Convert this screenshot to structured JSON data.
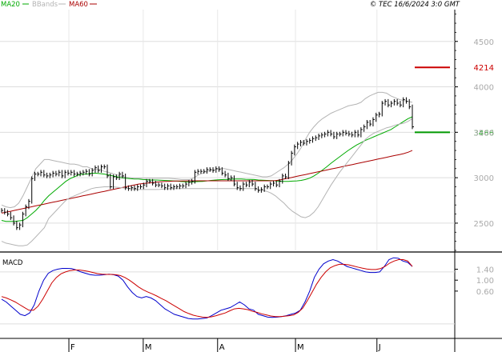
{
  "legend": [
    {
      "label": "MA20",
      "color": "#00aa00"
    },
    {
      "label": "BBands",
      "color": "#b4b4b4"
    },
    {
      "label": "MA60",
      "color": "#aa0000"
    }
  ],
  "copyright": "© TEC 16/6/2024 3:0 GMT",
  "macd_label": "MACD",
  "price_marker": {
    "label": "4214",
    "color": "#cc0000"
  },
  "last_marker": {
    "label": "3466",
    "color": "#009900"
  },
  "chart_data": [
    {
      "type": "line",
      "panel": "price",
      "ylim": [
        2200,
        4850
      ],
      "yticks": [
        2500,
        3000,
        3500,
        4000,
        4500
      ],
      "ytick_labels": [
        "2500",
        "3000",
        "3500",
        "4000",
        "4500"
      ],
      "grid": true,
      "x": [
        "01-04",
        "01-05",
        "01-08",
        "01-09",
        "01-10",
        "01-11",
        "01-12",
        "01-15",
        "01-16",
        "01-17",
        "01-18",
        "01-19",
        "01-22",
        "01-23",
        "01-24",
        "01-25",
        "01-26",
        "01-29",
        "01-30",
        "01-31",
        "02-01",
        "02-02",
        "02-05",
        "02-06",
        "02-07",
        "02-08",
        "02-09",
        "02-12",
        "02-13",
        "02-14",
        "02-15",
        "02-16",
        "02-19",
        "02-20",
        "02-21",
        "02-22",
        "02-23",
        "02-26",
        "02-27",
        "02-28",
        "02-29",
        "03-01",
        "03-04",
        "03-05",
        "03-06",
        "03-07",
        "03-08",
        "03-11",
        "03-12",
        "03-13",
        "03-14",
        "03-15",
        "03-18",
        "03-19",
        "03-20",
        "03-21",
        "03-22",
        "03-25",
        "03-26",
        "03-27",
        "03-28",
        "03-29",
        "04-01",
        "04-02",
        "04-03",
        "04-04",
        "04-05",
        "04-08",
        "04-09",
        "04-10",
        "04-11",
        "04-12",
        "04-15",
        "04-16",
        "04-17",
        "04-18",
        "04-19",
        "04-22",
        "04-23",
        "04-24",
        "04-25",
        "04-26",
        "04-29",
        "04-30",
        "05-01",
        "05-02",
        "05-03",
        "05-06",
        "05-07",
        "05-08",
        "05-09",
        "05-10",
        "05-13",
        "05-14",
        "05-15",
        "05-16",
        "05-17",
        "05-20",
        "05-21",
        "05-22",
        "05-23",
        "05-24",
        "05-27",
        "05-28",
        "05-29",
        "05-30",
        "05-31",
        "06-03",
        "06-04",
        "06-05",
        "06-06",
        "06-07",
        "06-10",
        "06-11",
        "06-12",
        "06-13",
        "06-14"
      ],
      "xtick_labels": [
        {
          "date": "01-31",
          "label": "F"
        },
        {
          "date": "02-29",
          "label": "M"
        },
        {
          "date": "03-29",
          "label": "A"
        },
        {
          "date": "04-30",
          "label": "M"
        },
        {
          "date": "05-31",
          "label": "J"
        }
      ],
      "price": [
        2640,
        2620,
        2600,
        2560,
        2500,
        2450,
        2480,
        2600,
        2680,
        2740,
        2990,
        3040,
        3040,
        3060,
        3030,
        3020,
        3030,
        3050,
        3040,
        3060,
        3020,
        3060,
        3050,
        3060,
        3040,
        3040,
        3050,
        3060,
        3070,
        3040,
        3080,
        3110,
        3080,
        3120,
        3120,
        3020,
        2900,
        3010,
        3000,
        3040,
        3020,
        2890,
        2880,
        2890,
        2880,
        2900,
        2900,
        2920,
        2960,
        2960,
        2940,
        2920,
        2920,
        2910,
        2890,
        2910,
        2890,
        2900,
        2900,
        2910,
        2910,
        2930,
        2950,
        2960,
        3060,
        3070,
        3070,
        3070,
        3090,
        3090,
        3080,
        3100,
        3090,
        3050,
        3030,
        2990,
        3000,
        2930,
        2890,
        2880,
        2930,
        2920,
        2950,
        2930,
        2880,
        2860,
        2870,
        2900,
        2900,
        2930,
        2940,
        2920,
        2960,
        3020,
        3010,
        3160,
        3270,
        3340,
        3370,
        3390,
        3380,
        3400,
        3410,
        3430,
        3440,
        3460,
        3470,
        3480,
        3500,
        3480,
        3450,
        3480,
        3480,
        3500,
        3490,
        3480,
        3470,
        3500,
        3470,
        3530,
        3560,
        3610,
        3590,
        3640,
        3690,
        3700,
        3820,
        3840,
        3800,
        3820,
        3840,
        3820,
        3800,
        3860,
        3840,
        3780,
        3560
      ],
      "series": [
        {
          "name": "MA20",
          "color": "#00aa00",
          "values": [
            2530,
            2520,
            2520,
            2520,
            2525,
            2530,
            2560,
            2600,
            2640,
            2690,
            2750,
            2800,
            2840,
            2880,
            2920,
            2960,
            2990,
            3010,
            3030,
            3040,
            3040,
            3050,
            3050,
            3045,
            3040,
            3030,
            3020,
            3010,
            3000,
            2995,
            2990,
            2985,
            2985,
            2980,
            2978,
            2975,
            2975,
            2972,
            2970,
            2968,
            2965,
            2962,
            2958,
            2955,
            2953,
            2955,
            2958,
            2960,
            2965,
            2970,
            2975,
            2978,
            2980,
            2982,
            2984,
            2985,
            2985,
            2983,
            2982,
            2980,
            2975,
            2972,
            2970,
            2968,
            2965,
            2962,
            2960,
            2960,
            2962,
            2965,
            2970,
            2980,
            2995,
            3020,
            3050,
            3085,
            3120,
            3160,
            3195,
            3230,
            3265,
            3300,
            3330,
            3360,
            3385,
            3410,
            3430,
            3450,
            3470,
            3490,
            3510,
            3530,
            3560,
            3590,
            3620,
            3650,
            3670
          ]
        },
        {
          "name": "MA60",
          "color": "#aa0000",
          "values": [
            2610,
            2620,
            2630,
            2640,
            2650,
            2660,
            2670,
            2680,
            2690,
            2700,
            2710,
            2720,
            2730,
            2740,
            2750,
            2760,
            2770,
            2780,
            2790,
            2800,
            2810,
            2820,
            2830,
            2840,
            2850,
            2860,
            2870,
            2880,
            2890,
            2900,
            2910,
            2920,
            2930,
            2935,
            2940,
            2945,
            2950,
            2955,
            2958,
            2960,
            2962,
            2963,
            2964,
            2965,
            2966,
            2966,
            2966,
            2966,
            2966,
            2966,
            2966,
            2966,
            2966,
            2966,
            2966,
            2966,
            2966,
            2966,
            2966,
            2966,
            2966,
            2966,
            2966,
            2966,
            2968,
            2975,
            2985,
            2995,
            3005,
            3015,
            3025,
            3035,
            3045,
            3055,
            3065,
            3075,
            3085,
            3095,
            3105,
            3115,
            3125,
            3135,
            3145,
            3155,
            3165,
            3175,
            3185,
            3195,
            3205,
            3215,
            3225,
            3235,
            3245,
            3255,
            3265,
            3280,
            3300
          ]
        },
        {
          "name": "BBands upper",
          "color": "#b4b4b4",
          "values": [
            2700,
            2680,
            2670,
            2680,
            2720,
            2800,
            2900,
            3000,
            3100,
            3150,
            3200,
            3200,
            3190,
            3180,
            3170,
            3160,
            3150,
            3150,
            3140,
            3120,
            3120,
            3100,
            3090,
            3090,
            3070,
            3060,
            3045,
            3030,
            3015,
            3005,
            3000,
            2995,
            2995,
            2995,
            2995,
            2995,
            2995,
            2995,
            2995,
            2995,
            2990,
            2985,
            2980,
            2980,
            2980,
            3000,
            3030,
            3050,
            3070,
            3080,
            3090,
            3100,
            3100,
            3090,
            3080,
            3070,
            3060,
            3050,
            3040,
            3030,
            3020,
            3010,
            3010,
            3020,
            3050,
            3080,
            3110,
            3150,
            3200,
            3260,
            3330,
            3420,
            3500,
            3560,
            3610,
            3650,
            3680,
            3710,
            3730,
            3750,
            3770,
            3790,
            3800,
            3810,
            3830,
            3870,
            3900,
            3920,
            3940,
            3940,
            3930,
            3900,
            3880,
            3860,
            3850,
            3840,
            3830
          ]
        },
        {
          "name": "BBands lower",
          "color": "#b4b4b4",
          "values": [
            2300,
            2280,
            2270,
            2260,
            2250,
            2250,
            2260,
            2300,
            2350,
            2400,
            2450,
            2550,
            2600,
            2650,
            2700,
            2750,
            2780,
            2800,
            2820,
            2840,
            2860,
            2880,
            2890,
            2895,
            2900,
            2900,
            2900,
            2895,
            2890,
            2885,
            2880,
            2875,
            2870,
            2870,
            2870,
            2870,
            2870,
            2872,
            2875,
            2878,
            2880,
            2880,
            2880,
            2880,
            2880,
            2880,
            2880,
            2880,
            2880,
            2880,
            2880,
            2880,
            2880,
            2880,
            2880,
            2880,
            2880,
            2880,
            2880,
            2880,
            2870,
            2860,
            2850,
            2830,
            2800,
            2760,
            2720,
            2670,
            2630,
            2600,
            2570,
            2560,
            2580,
            2620,
            2680,
            2760,
            2840,
            2920,
            2990,
            3060,
            3120,
            3180,
            3240,
            3300,
            3360,
            3420,
            3460,
            3490,
            3510,
            3530,
            3550,
            3560,
            3580,
            3590,
            3600,
            3620,
            3650
          ]
        }
      ],
      "markers": [
        {
          "value": 4214,
          "label": "4214",
          "color": "#cc0000"
        },
        {
          "value": 3500,
          "label": "3466",
          "color": "#009900"
        }
      ]
    },
    {
      "type": "line",
      "panel": "MACD",
      "ylim": [
        -110,
        200
      ],
      "yticks": [
        60,
        100,
        140
      ],
      "ytick_labels": [
        "0.60",
        "1.00",
        "1.40"
      ],
      "grid": true,
      "series": [
        {
          "name": "MACD",
          "color": "#0000cc",
          "values": [
            30,
            20,
            5,
            -10,
            -25,
            -30,
            -20,
            10,
            60,
            100,
            125,
            135,
            140,
            143,
            143,
            142,
            137,
            130,
            125,
            120,
            118,
            118,
            120,
            122,
            120,
            115,
            100,
            75,
            55,
            40,
            35,
            40,
            35,
            25,
            10,
            -5,
            -15,
            -25,
            -30,
            -35,
            -40,
            -42,
            -42,
            -40,
            -38,
            -30,
            -20,
            -10,
            -5,
            0,
            10,
            20,
            10,
            -5,
            -10,
            -25,
            -30,
            -35,
            -36,
            -35,
            -33,
            -30,
            -25,
            -20,
            -10,
            20,
            60,
            110,
            140,
            160,
            170,
            175,
            170,
            160,
            150,
            145,
            140,
            135,
            130,
            128,
            128,
            130,
            150,
            175,
            182,
            180,
            170,
            165,
            150
          ]
        },
        {
          "name": "Signal",
          "color": "#cc0000",
          "values": [
            40,
            35,
            28,
            20,
            10,
            0,
            -10,
            -10,
            5,
            30,
            60,
            90,
            110,
            123,
            130,
            135,
            137,
            137,
            135,
            132,
            128,
            124,
            122,
            121,
            121,
            120,
            117,
            110,
            100,
            88,
            75,
            65,
            57,
            50,
            42,
            33,
            25,
            15,
            5,
            -5,
            -15,
            -22,
            -28,
            -32,
            -35,
            -36,
            -34,
            -30,
            -25,
            -20,
            -12,
            -5,
            -3,
            -5,
            -8,
            -14,
            -18,
            -23,
            -27,
            -31,
            -33,
            -33,
            -32,
            -30,
            -27,
            -18,
            -2,
            25,
            55,
            85,
            110,
            130,
            145,
            153,
            158,
            158,
            156,
            152,
            148,
            144,
            141,
            139,
            139,
            142,
            150,
            162,
            170,
            175,
            175,
            170,
            150
          ]
        }
      ]
    }
  ]
}
